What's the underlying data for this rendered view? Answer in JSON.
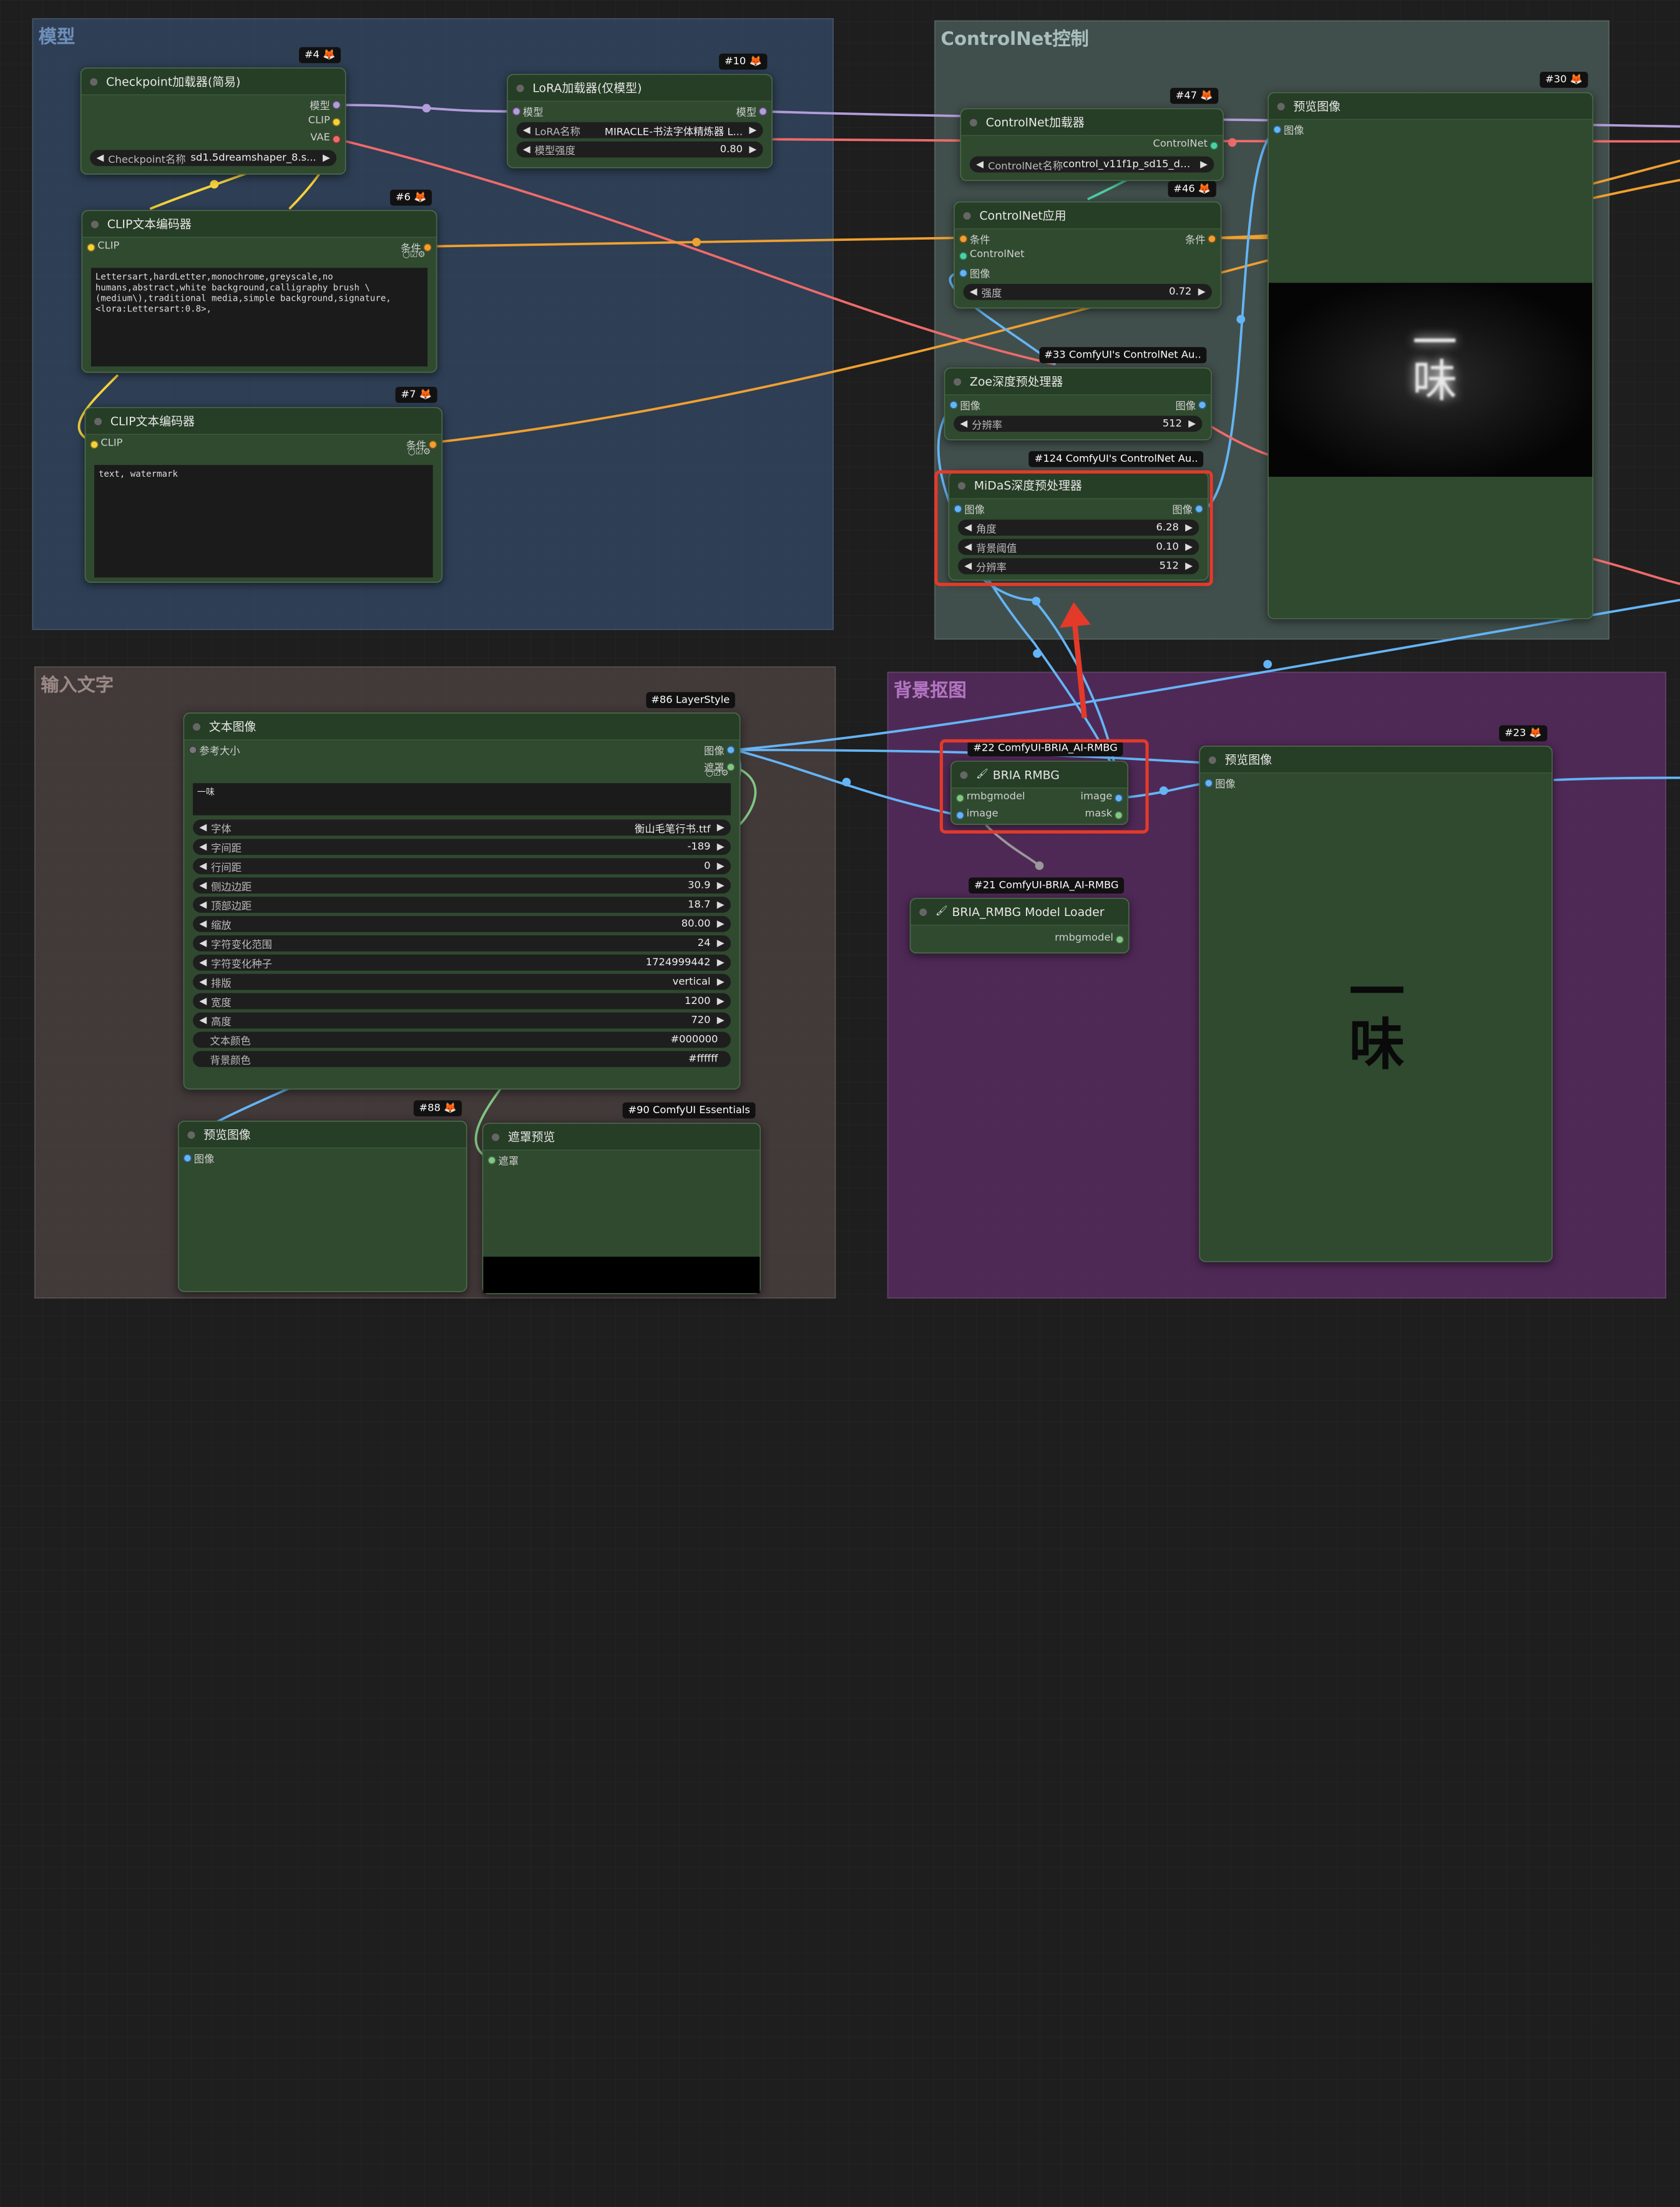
{
  "groups": {
    "model": {
      "title": "模型"
    },
    "controlnet": {
      "title": "ControlNet控制"
    },
    "input_text": {
      "title": "输入文字"
    },
    "bg_removal": {
      "title": "背景抠图"
    }
  },
  "nodes": {
    "checkpoint": {
      "badge": "#4 🦊",
      "title": "Checkpoint加载器(简易)",
      "out_model": "模型",
      "out_clip": "CLIP",
      "out_vae": "VAE",
      "w1_label": "Checkpoint名称",
      "w1_value": "sd1.5dreamshaper_8.s..."
    },
    "lora": {
      "badge": "#10 🦊",
      "title": "LoRA加载器(仅模型)",
      "in_model": "模型",
      "out_model": "模型",
      "w1_label": "LoRA名称",
      "w1_value": "MIRACLE-书法字体精炼器 L...",
      "w2_label": "模型强度",
      "w2_value": "0.80"
    },
    "clip_pos": {
      "badge": "#6 🦊",
      "title": "CLIP文本编码器",
      "in_clip": "CLIP",
      "out_cond": "条件",
      "text": "Lettersart,hardLetter,monochrome,greyscale,no\nhumans,abstract,white background,calligraphy brush \\\n(medium\\),traditional media,simple background,signature,\n<lora:Lettersart:0.8>,"
    },
    "clip_neg": {
      "badge": "#7 🦊",
      "title": "CLIP文本编码器",
      "in_clip": "CLIP",
      "out_cond": "条件",
      "text": "text, watermark"
    },
    "cn_loader": {
      "badge": "#47 🦊",
      "title": "ControlNet加载器",
      "out_cn": "ControlNet",
      "w1_label": "ControlNet名称",
      "w1_value": "control_v11f1p_sd15_de..."
    },
    "cn_apply": {
      "badge": "#46 🦊",
      "title": "ControlNet应用",
      "in_cond": "条件",
      "in_cn": "ControlNet",
      "in_image": "图像",
      "out_cond": "条件",
      "w1_label": "强度",
      "w1_value": "0.72"
    },
    "zoe": {
      "badge": "#33 ComfyUI's ControlNet Au..",
      "title": "Zoe深度预处理器",
      "in_image": "图像",
      "out_image": "图像",
      "w1_label": "分辨率",
      "w1_value": "512"
    },
    "midas": {
      "badge": "#124 ComfyUI's ControlNet Au..",
      "title": "MiDaS深度预处理器",
      "in_image": "图像",
      "out_image": "图像",
      "w1_label": "角度",
      "w1_value": "6.28",
      "w2_label": "背景阈值",
      "w2_value": "0.10",
      "w3_label": "分辨率",
      "w3_value": "512"
    },
    "preview30": {
      "badge": "#30 🦊",
      "title": "预览图像",
      "in_image": "图像",
      "glyphs": "一\n味"
    },
    "text_image": {
      "badge": "#86 LayerStyle",
      "title": "文本图像",
      "in_ref": "参考大小",
      "out_image": "图像",
      "out_mask": "遮罩",
      "text": "一味",
      "widgets": [
        {
          "label": "字体",
          "value": "衡山毛笔行书.ttf"
        },
        {
          "label": "字间距",
          "value": "-189"
        },
        {
          "label": "行间距",
          "value": "0"
        },
        {
          "label": "侧边边距",
          "value": "30.9"
        },
        {
          "label": "顶部边距",
          "value": "18.7"
        },
        {
          "label": "缩放",
          "value": "80.00"
        },
        {
          "label": "字符变化范围",
          "value": "24"
        },
        {
          "label": "字符变化种子",
          "value": "1724999442"
        },
        {
          "label": "排版",
          "value": "vertical"
        },
        {
          "label": "宽度",
          "value": "1200"
        },
        {
          "label": "高度",
          "value": "720"
        }
      ],
      "text_color_label": "文本颜色",
      "text_color_value": "#000000",
      "bg_color_label": "背景颜色",
      "bg_color_value": "#ffffff"
    },
    "bria": {
      "badge": "#22 ComfyUI-BRIA_AI-RMBG",
      "title": "BRIA RMBG",
      "in_model": "rmbgmodel",
      "in_image": "image",
      "out_image": "image",
      "out_mask": "mask"
    },
    "bria_loader": {
      "badge": "#21 ComfyUI-BRIA_AI-RMBG",
      "title": "BRIA_RMBG Model Loader",
      "out_model": "rmbgmodel"
    },
    "preview23": {
      "badge": "#23 🦊",
      "title": "预览图像",
      "in_image": "图像",
      "glyphs": "一\n味"
    },
    "preview88": {
      "badge": "#88 🦊",
      "title": "预览图像",
      "in_image": "图像"
    },
    "mask_preview": {
      "badge": "#90 ComfyUI Essentials",
      "title": "遮罩预览",
      "in_mask": "遮罩"
    }
  },
  "colors": {
    "accent_highlight": "#e33a2a",
    "wire_model": "#b39ddb",
    "wire_clip": "#f5d23a",
    "wire_vae": "#ef6b6b",
    "wire_cond": "#f0a030",
    "wire_image": "#64b5f6",
    "wire_mask": "#81c784",
    "wire_controlnet": "#4dd0a1",
    "node_bg": "#2f4a2f"
  }
}
